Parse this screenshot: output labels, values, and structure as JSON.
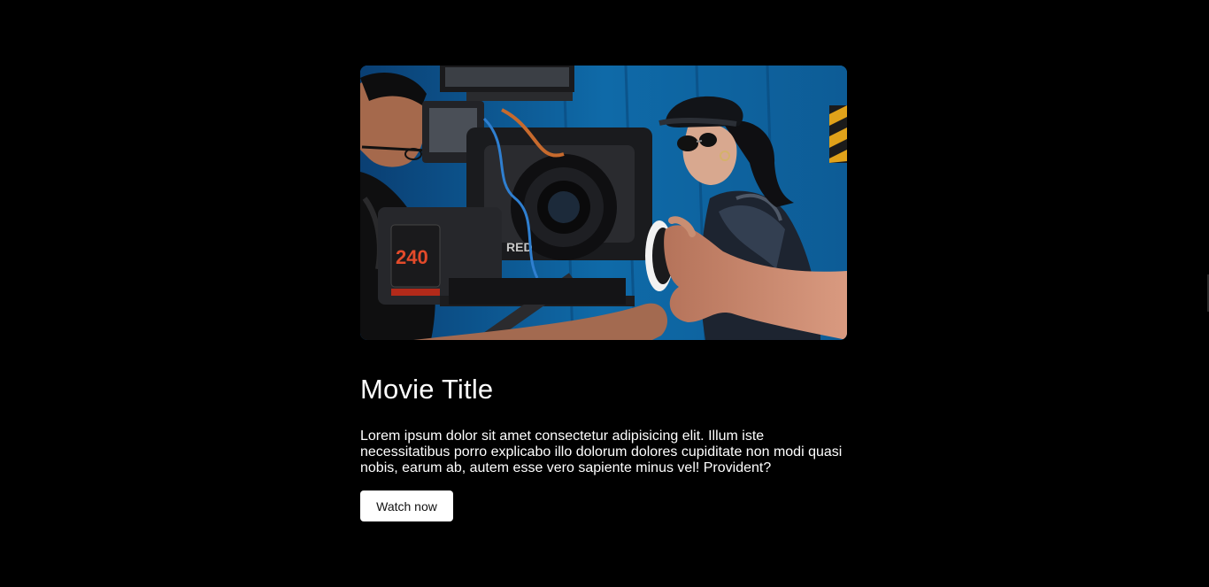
{
  "movie": {
    "title": "Movie Title",
    "description": "Lorem ipsum dolor sit amet consectetur adipisicing elit. Illum iste necessitatibus porro explicabo illo dolorum dolores cupiditate non modi quasi nobis, earum ab, autem esse vero sapiente minus vel! Provident?",
    "cta_label": "Watch now",
    "image_alt": "film-crew-camera-photo"
  },
  "camera_battery_label": "240",
  "camera_brand_label": "RED",
  "colors": {
    "background": "#000000",
    "text": "#ffffff",
    "button_bg": "#ffffff",
    "button_text": "#111111",
    "hero_backdrop": "#0b5a9a"
  }
}
